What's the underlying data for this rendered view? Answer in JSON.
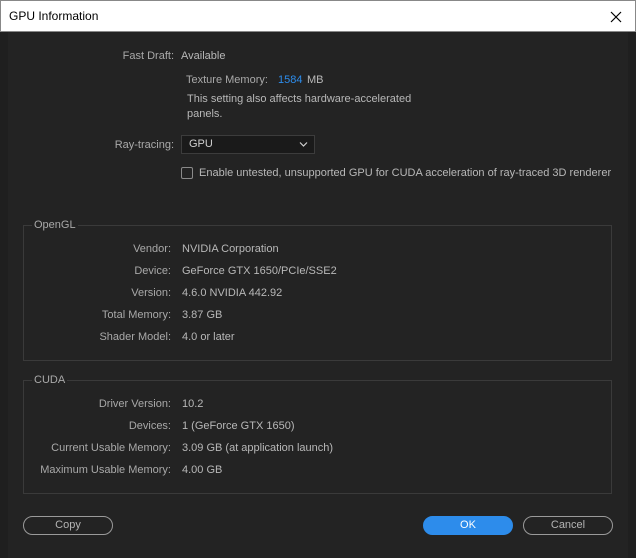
{
  "window": {
    "title": "GPU Information"
  },
  "fast_draft": {
    "label": "Fast Draft:",
    "value": "Available",
    "texture_memory_label": "Texture Memory:",
    "texture_memory_value": "1584",
    "texture_memory_unit": "MB",
    "note_line1": "This setting also affects hardware-accelerated",
    "note_line2": "panels."
  },
  "ray_tracing": {
    "label": "Ray-tracing:",
    "selected": "GPU",
    "checkbox_label": "Enable untested, unsupported GPU for CUDA acceleration of ray-traced 3D renderer",
    "checked": false
  },
  "opengl": {
    "title": "OpenGL",
    "rows": [
      {
        "label": "Vendor:",
        "value": "NVIDIA Corporation"
      },
      {
        "label": "Device:",
        "value": "GeForce GTX 1650/PCIe/SSE2"
      },
      {
        "label": "Version:",
        "value": "4.6.0 NVIDIA 442.92"
      },
      {
        "label": "Total Memory:",
        "value": "3.87 GB"
      },
      {
        "label": "Shader Model:",
        "value": "4.0 or later"
      }
    ]
  },
  "cuda": {
    "title": "CUDA",
    "rows": [
      {
        "label": "Driver Version:",
        "value": "10.2"
      },
      {
        "label": "Devices:",
        "value": "1 (GeForce GTX 1650)"
      },
      {
        "label": "Current Usable Memory:",
        "value": "3.09 GB (at application launch)"
      },
      {
        "label": "Maximum Usable Memory:",
        "value": "4.00 GB"
      }
    ]
  },
  "buttons": {
    "copy": "Copy",
    "ok": "OK",
    "cancel": "Cancel"
  },
  "icons": {
    "close": "close-icon",
    "dropdown": "chevron-down-icon"
  },
  "colors": {
    "accent": "#2d8ceb",
    "background": "#232323",
    "titlebar": "#ffffff"
  }
}
